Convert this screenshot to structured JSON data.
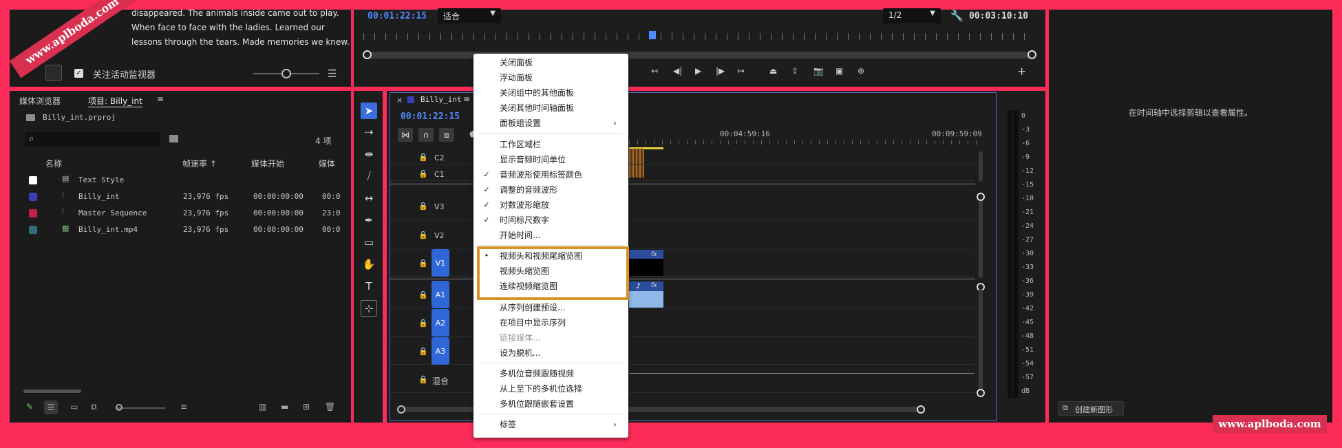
{
  "watermark": {
    "top_left": "www.aplboda.com",
    "bottom_right": "www.aplboda.com"
  },
  "text_panel": {
    "lines": [
      "disappeared. The animals inside came out to play.",
      "When face to face with the ladies. Learned our",
      "lessons through the tears. Made memories we knew."
    ],
    "follow_monitor_label": "关注活动监视器"
  },
  "program_monitor": {
    "timecode": "00:01:22:15",
    "fit_select": "适合",
    "resolution_select": "1/2",
    "duration": "00:03:10:10"
  },
  "project_panel": {
    "tabs": [
      "媒体浏览器",
      "项目: Billy_int"
    ],
    "project_file": "Billy_int.prproj",
    "item_count": "4 项",
    "search_placeholder": "",
    "columns": [
      "名称",
      "帧速率",
      "媒体开始",
      "媒体"
    ],
    "rows": [
      {
        "color": "#ffffff",
        "name": "Text Style",
        "fps": "",
        "start": "",
        "end": ""
      },
      {
        "color": "#3a3fb8",
        "name": "Billy_int",
        "fps": "23,976 fps",
        "start": "00:00:00:00",
        "end": "00:0"
      },
      {
        "color": "#c0224a",
        "name": "Master Sequence",
        "fps": "23,976 fps",
        "start": "00:00:00:00",
        "end": "23:0"
      },
      {
        "color": "#2f6f7a",
        "name": "Billy_int.mp4",
        "fps": "23,976 fps",
        "start": "00:00:00:00",
        "end": "00:0"
      }
    ]
  },
  "timeline": {
    "tab": "Billy_int",
    "timecode": "00:01:22:15",
    "ruler": [
      "00:04:59:16",
      "00:09:59:09"
    ],
    "tracks": {
      "c2": "C2",
      "c1": "C1",
      "v3": "V3",
      "v2": "V2",
      "v1": "V1",
      "a1": "A1",
      "a2": "A2",
      "a3": "A3",
      "mix": "混合"
    }
  },
  "meter_labels": [
    "0",
    "-3",
    "-6",
    "-9",
    "-12",
    "-15",
    "-18",
    "-21",
    "-24",
    "-27",
    "-30",
    "-33",
    "-36",
    "-39",
    "-42",
    "-45",
    "-48",
    "-51",
    "-54",
    "-57",
    "dB"
  ],
  "properties_panel": {
    "hint": "在时间轴中选择剪辑以查看属性。",
    "new_graphic_button": "创建新图形"
  },
  "context_menu": {
    "items": [
      {
        "label": "关闭面板",
        "check": "",
        "arrow": "",
        "disabled": false
      },
      {
        "label": "浮动面板",
        "check": "",
        "arrow": "",
        "disabled": false
      },
      {
        "label": "关闭组中的其他面板",
        "check": "",
        "arrow": "",
        "disabled": false
      },
      {
        "label": "关闭其他时间轴面板",
        "check": "",
        "arrow": "",
        "disabled": false
      },
      {
        "label": "面板组设置",
        "check": "",
        "arrow": "›",
        "disabled": false
      },
      {
        "label": "工作区域栏",
        "check": "",
        "arrow": "",
        "disabled": false
      },
      {
        "label": "显示音频时间单位",
        "check": "",
        "arrow": "",
        "disabled": false
      },
      {
        "label": "音频波形使用标签颜色",
        "check": "✓",
        "arrow": "",
        "disabled": false
      },
      {
        "label": "调整的音频波形",
        "check": "✓",
        "arrow": "",
        "disabled": false
      },
      {
        "label": "对数波形缩放",
        "check": "✓",
        "arrow": "",
        "disabled": false
      },
      {
        "label": "时间标尺数字",
        "check": "✓",
        "arrow": "",
        "disabled": false
      },
      {
        "label": "开始时间...",
        "check": "",
        "arrow": "",
        "disabled": false
      },
      {
        "label": "视频头和视频尾缩览图",
        "check": "•",
        "arrow": "",
        "disabled": false
      },
      {
        "label": "视频头缩览图",
        "check": "",
        "arrow": "",
        "disabled": false
      },
      {
        "label": "连续视频缩览图",
        "check": "",
        "arrow": "",
        "disabled": false
      },
      {
        "label": "从序列创建预设...",
        "check": "",
        "arrow": "",
        "disabled": false
      },
      {
        "label": "在项目中显示序列",
        "check": "",
        "arrow": "",
        "disabled": false
      },
      {
        "label": "链接媒体...",
        "check": "",
        "arrow": "",
        "disabled": true
      },
      {
        "label": "设为脱机...",
        "check": "",
        "arrow": "",
        "disabled": false
      },
      {
        "label": "多机位音频跟随视频",
        "check": "",
        "arrow": "",
        "disabled": false
      },
      {
        "label": "从上至下的多机位选择",
        "check": "",
        "arrow": "",
        "disabled": false
      },
      {
        "label": "多机位跟随嵌套设置",
        "check": "",
        "arrow": "",
        "disabled": false
      },
      {
        "label": "标签",
        "check": "",
        "arrow": "›",
        "disabled": false
      }
    ]
  },
  "colors": {
    "accent_blue": "#2f66d8",
    "highlight_orange": "#d99223",
    "frame_pink": "#fb2b5a"
  }
}
